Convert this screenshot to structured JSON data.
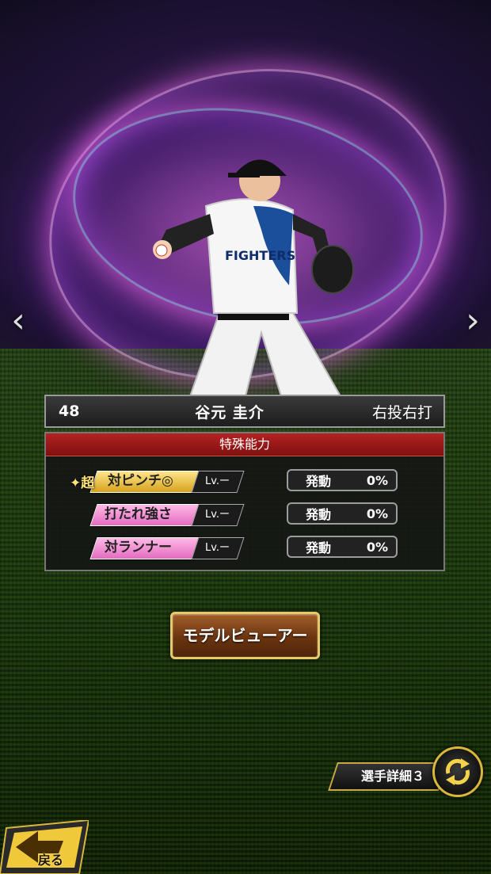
{
  "player": {
    "number": "48",
    "name": "谷元 圭介",
    "handedness": "右投右打"
  },
  "abilities_panel": {
    "title": "特殊能力",
    "items": [
      {
        "super_prefix": "超",
        "label": "対ピンチ◎",
        "level": "Lv.ー",
        "status": "発動",
        "percent": "0%",
        "tier": "gold"
      },
      {
        "super_prefix": "",
        "label": "打たれ強さ",
        "level": "Lv.ー",
        "status": "発動",
        "percent": "0%",
        "tier": "pink"
      },
      {
        "super_prefix": "",
        "label": "対ランナー",
        "level": "Lv.ー",
        "status": "発動",
        "percent": "0%",
        "tier": "pink"
      }
    ]
  },
  "buttons": {
    "model_viewer": "モデルビューアー",
    "player_detail": "選手詳細３",
    "back": "戻る"
  },
  "icons": {
    "prev": "chevron-left-icon",
    "next": "chevron-right-icon",
    "cycle": "cycle-arrows-icon",
    "back": "back-arrow-icon"
  },
  "colors": {
    "title_bar": "#b52222",
    "gold_tag": "#f3c84a",
    "pink_tag": "#f08ed3",
    "button_border": "#e8c96a"
  }
}
